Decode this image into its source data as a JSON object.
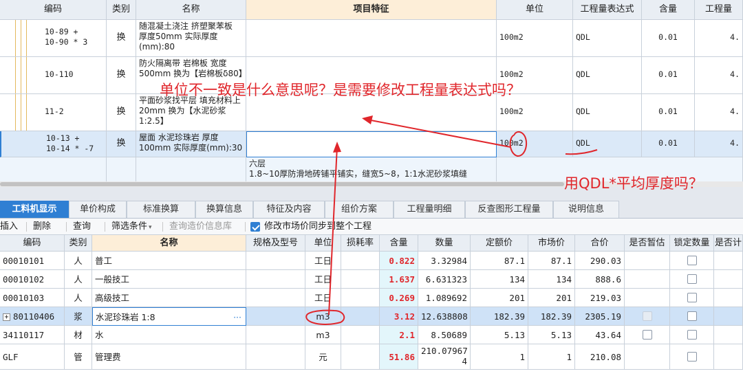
{
  "top_table": {
    "headers": [
      "编码",
      "类别",
      "名称",
      "项目特征",
      "单位",
      "工程量表达式",
      "含量",
      "工程量"
    ],
    "rows": [
      {
        "code": "10-89 +\n10-90 * 3",
        "type": "换",
        "name": "随混凝土浇注 挤塑聚苯板 厚度50mm  实际厚度(mm):80",
        "feature": "",
        "unit": "100m2",
        "expr": "QDL",
        "content": "0.01",
        "qty": "4."
      },
      {
        "code": "10-110",
        "type": "换",
        "name": "防火隔离带 岩棉板 宽度500mm  换为【岩棉板δ80】",
        "feature": "",
        "unit": "100m2",
        "expr": "QDL",
        "content": "0.01",
        "qty": "4."
      },
      {
        "code": "11-2",
        "type": "换",
        "name": "平面砂浆找平层 填充材料上 20mm  换为【水泥砂浆 1:2.5】",
        "feature": "",
        "unit": "100m2",
        "expr": "QDL",
        "content": "0.01",
        "qty": "4."
      },
      {
        "code": "10-13 +\n10-14 * -7",
        "type": "换",
        "name": "屋面 水泥珍珠岩 厚度100mm  实际厚度(mm):30",
        "feature": "",
        "unit": "100m2",
        "expr": "QDL",
        "content": "0.01",
        "qty": "4."
      }
    ],
    "partial_row": {
      "feature": "六层\n1.8~10厚防滑地砖铺平铺实，缝宽5~8，1:1水泥砂浆填缝"
    }
  },
  "tabs": [
    "工料机显示",
    "单价构成",
    "标准换算",
    "换算信息",
    "特征及内容",
    "组价方案",
    "工程量明细",
    "反查图形工程量",
    "说明信息"
  ],
  "toolbar": {
    "insert": "插入",
    "delete": "删除",
    "query": "查询",
    "filter": "筛选条件",
    "query_price": "查询造价信息库",
    "sync_label": "修改市场价同步到整个工程"
  },
  "bottom_table": {
    "headers": [
      "编码",
      "类别",
      "名称",
      "规格及型号",
      "单位",
      "损耗率",
      "含量",
      "数量",
      "定额价",
      "市场价",
      "合价",
      "是否暂估",
      "锁定数量",
      "是否计"
    ],
    "rows": [
      {
        "code": "00010101",
        "type": "人",
        "name": "普工",
        "spec": "",
        "unit": "工日",
        "loss": "",
        "content": "0.822",
        "qty": "3.32984",
        "quota": "87.1",
        "market": "87.1",
        "total": "290.03"
      },
      {
        "code": "00010102",
        "type": "人",
        "name": "一般技工",
        "spec": "",
        "unit": "工日",
        "loss": "",
        "content": "1.637",
        "qty": "6.631323",
        "quota": "134",
        "market": "134",
        "total": "888.6"
      },
      {
        "code": "00010103",
        "type": "人",
        "name": "高级技工",
        "spec": "",
        "unit": "工日",
        "loss": "",
        "content": "0.269",
        "qty": "1.089692",
        "quota": "201",
        "market": "201",
        "total": "219.03"
      },
      {
        "code": "80110406",
        "type": "浆",
        "name": "水泥珍珠岩 1:8",
        "spec": "",
        "unit": "m3",
        "loss": "",
        "content": "3.12",
        "qty": "12.638808",
        "quota": "182.39",
        "market": "182.39",
        "total": "2305.19"
      },
      {
        "code": "34110117",
        "type": "材",
        "name": "水",
        "spec": "",
        "unit": "m3",
        "loss": "",
        "content": "2.1",
        "qty": "8.50689",
        "quota": "5.13",
        "market": "5.13",
        "total": "43.64"
      },
      {
        "code": "GLF",
        "type": "管",
        "name": "管理费",
        "spec": "",
        "unit": "元",
        "loss": "",
        "content": "51.86",
        "qty": "210.07967\n4",
        "quota": "1",
        "market": "1",
        "total": "210.08"
      }
    ]
  },
  "annotations": {
    "question1": "单位不一致是什么意思呢？是需要修改工程量表达式吗？",
    "question2": "用QDL*平均厚度吗？"
  },
  "colors": {
    "accent": "#2f7fd3",
    "annotation": "#e0262b",
    "feature_header": "#fdeed8"
  }
}
